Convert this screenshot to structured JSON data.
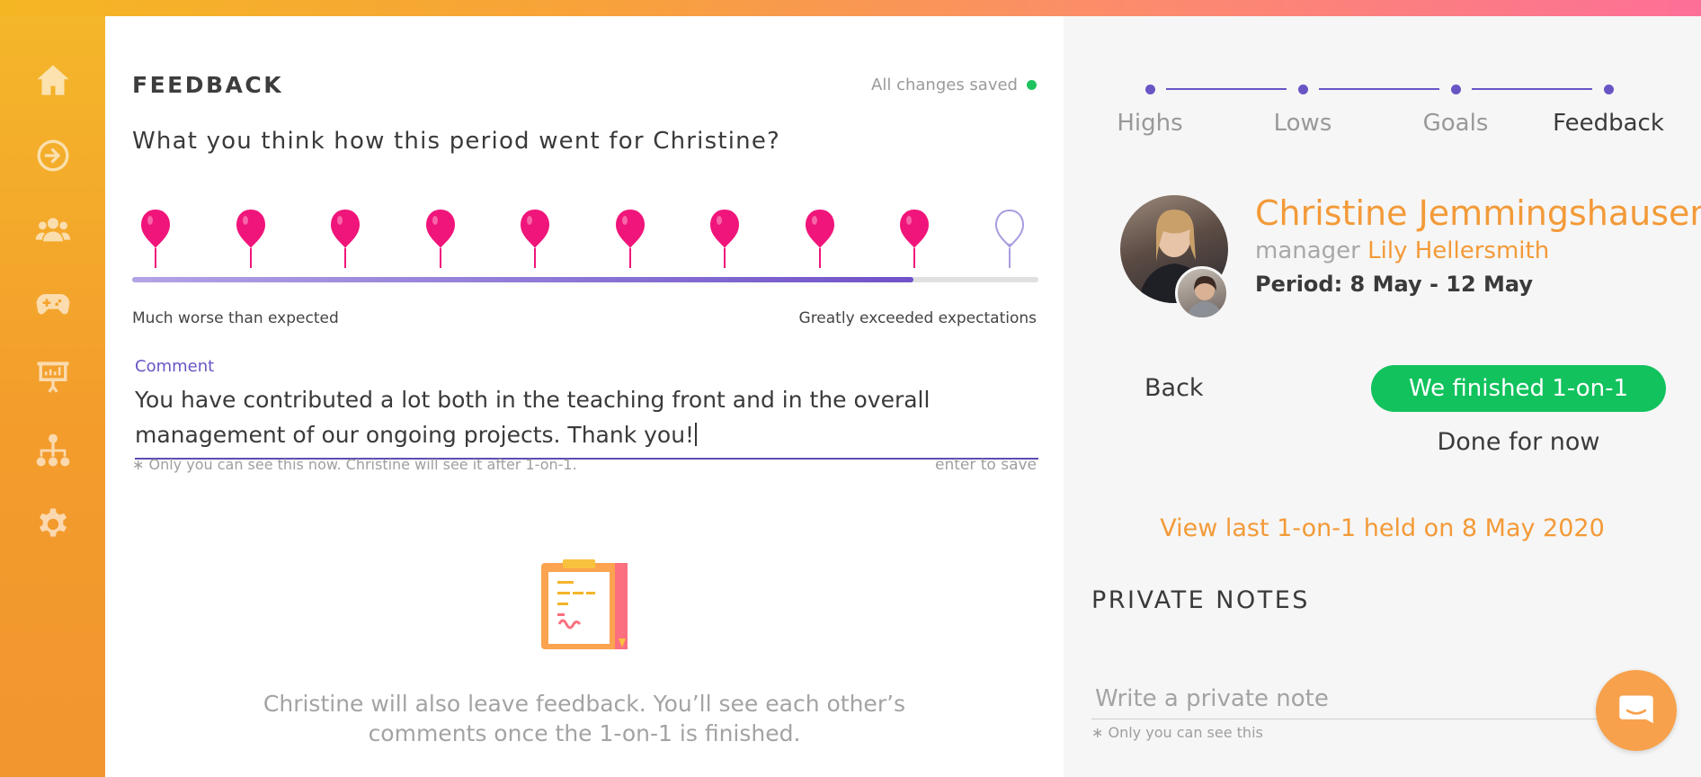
{
  "colors": {
    "accent": "#f39a38",
    "purple": "#6a55c5",
    "green": "#12c25d",
    "balloon": "#f0157a"
  },
  "sidebar": {
    "items": [
      {
        "icon": "home-icon"
      },
      {
        "icon": "arrow-right-circle-icon"
      },
      {
        "icon": "users-icon"
      },
      {
        "icon": "gamepad-icon"
      },
      {
        "icon": "presentation-icon"
      },
      {
        "icon": "org-chart-icon"
      },
      {
        "icon": "gear-icon"
      }
    ]
  },
  "feedback": {
    "title": "FEEDBACK",
    "saved_status": "All changes saved",
    "question": "What you think how this period went for Christine?",
    "rating": {
      "value": 9,
      "max": 10
    },
    "scale_min_label": "Much worse than expected",
    "scale_max_label": "Greatly exceeded expectations",
    "comment_label": "Comment",
    "comment_value": "You have contributed a lot both in the teaching front and in the overall management of our ongoing projects. Thank you!",
    "comment_hint": "∗ Only you can see this now. Christine will see it after 1-on-1.",
    "enter_to_save": "enter to save",
    "empty_note": "Christine will also leave feedback. You’ll see each other’s comments once the 1-on-1 is finished."
  },
  "steps": [
    {
      "label": "Highs",
      "active": false
    },
    {
      "label": "Lows",
      "active": false
    },
    {
      "label": "Goals",
      "active": false
    },
    {
      "label": "Feedback",
      "active": true
    }
  ],
  "person": {
    "name": "Christine Jemmingshausen",
    "manager_prefix": "manager",
    "manager_name": "Lily Hellersmith",
    "period": "Period: 8 May - 12 May"
  },
  "actions": {
    "back": "Back",
    "finish": "We finished 1-on-1",
    "done": "Done for now",
    "last_link": "View last 1-on-1 held on 8 May 2020"
  },
  "notes": {
    "title": "PRIVATE NOTES",
    "placeholder": "Write a private note",
    "hint": "∗ Only you can see this"
  }
}
